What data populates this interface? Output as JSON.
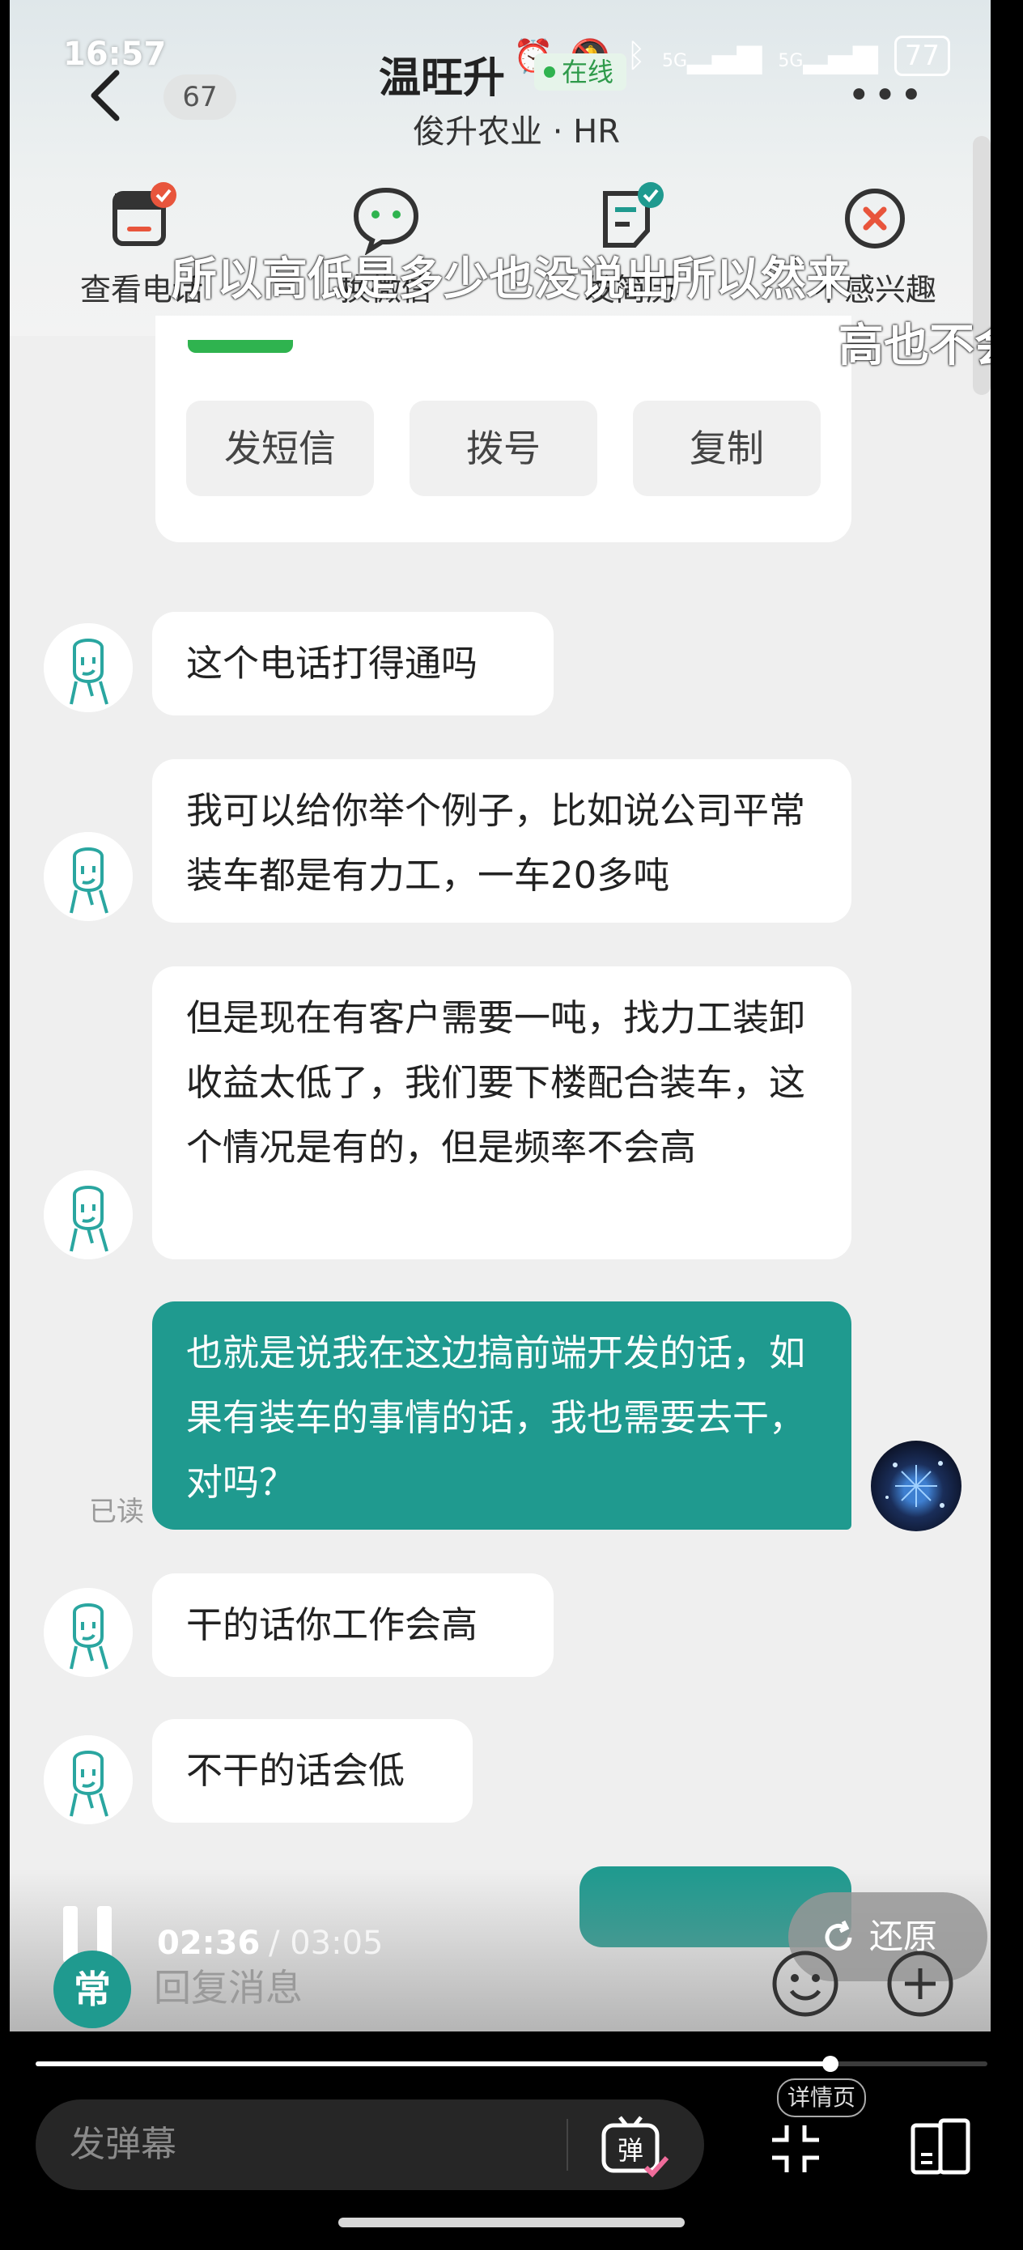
{
  "status_bar": {
    "time": "16:57",
    "battery": "77",
    "net1": "5G",
    "net2": "5G"
  },
  "header": {
    "unread_count": "67",
    "contact_name": "温旺升",
    "online_status": "在线",
    "company_role": "俊升农业 · HR"
  },
  "actions": [
    {
      "label": "查看电话",
      "icon": "phone-card-icon"
    },
    {
      "label": "换微信",
      "icon": "wechat-bubble-icon"
    },
    {
      "label": "发简历",
      "icon": "resume-icon"
    },
    {
      "label": "不感兴趣",
      "icon": "not-interested-icon"
    }
  ],
  "subtitles": {
    "line1": "所以高低是多少也没说出所以然来",
    "line2": "高也不会高"
  },
  "phone_card": {
    "buttons": [
      "发短信",
      "拨号",
      "复制"
    ]
  },
  "messages": [
    {
      "from": "hr",
      "text": "这个电话打得通吗"
    },
    {
      "from": "hr",
      "text": "我可以给你举个例子，比如说公司平常装车都是有力工，一车20多吨"
    },
    {
      "from": "hr",
      "text": "但是现在有客户需要一吨，找力工装卸收益太低了，我们要下楼配合装车，这个情况是有的，但是频率不会高"
    },
    {
      "from": "me",
      "text": "也就是说我在这边搞前端开发的话，如果有装车的事情的话，我也需要去干，对吗？",
      "read": "已读"
    },
    {
      "from": "hr",
      "text": "干的话你工作会高"
    },
    {
      "from": "hr",
      "text": "不干的话会低"
    }
  ],
  "video_overlay": {
    "elapsed": "02:36",
    "duration": "/ 03:05",
    "progress": 0.835,
    "restore_label": "还原"
  },
  "composer": {
    "quick_label": "常",
    "placeholder": "回复消息"
  },
  "player": {
    "danmaku_placeholder": "发弹幕",
    "danmaku_button": "弹",
    "detail_label": "详情页"
  },
  "colors": {
    "accent_teal": "#1f9a8f",
    "online_green": "#2fb34f",
    "badge_red": "#e8553c"
  }
}
